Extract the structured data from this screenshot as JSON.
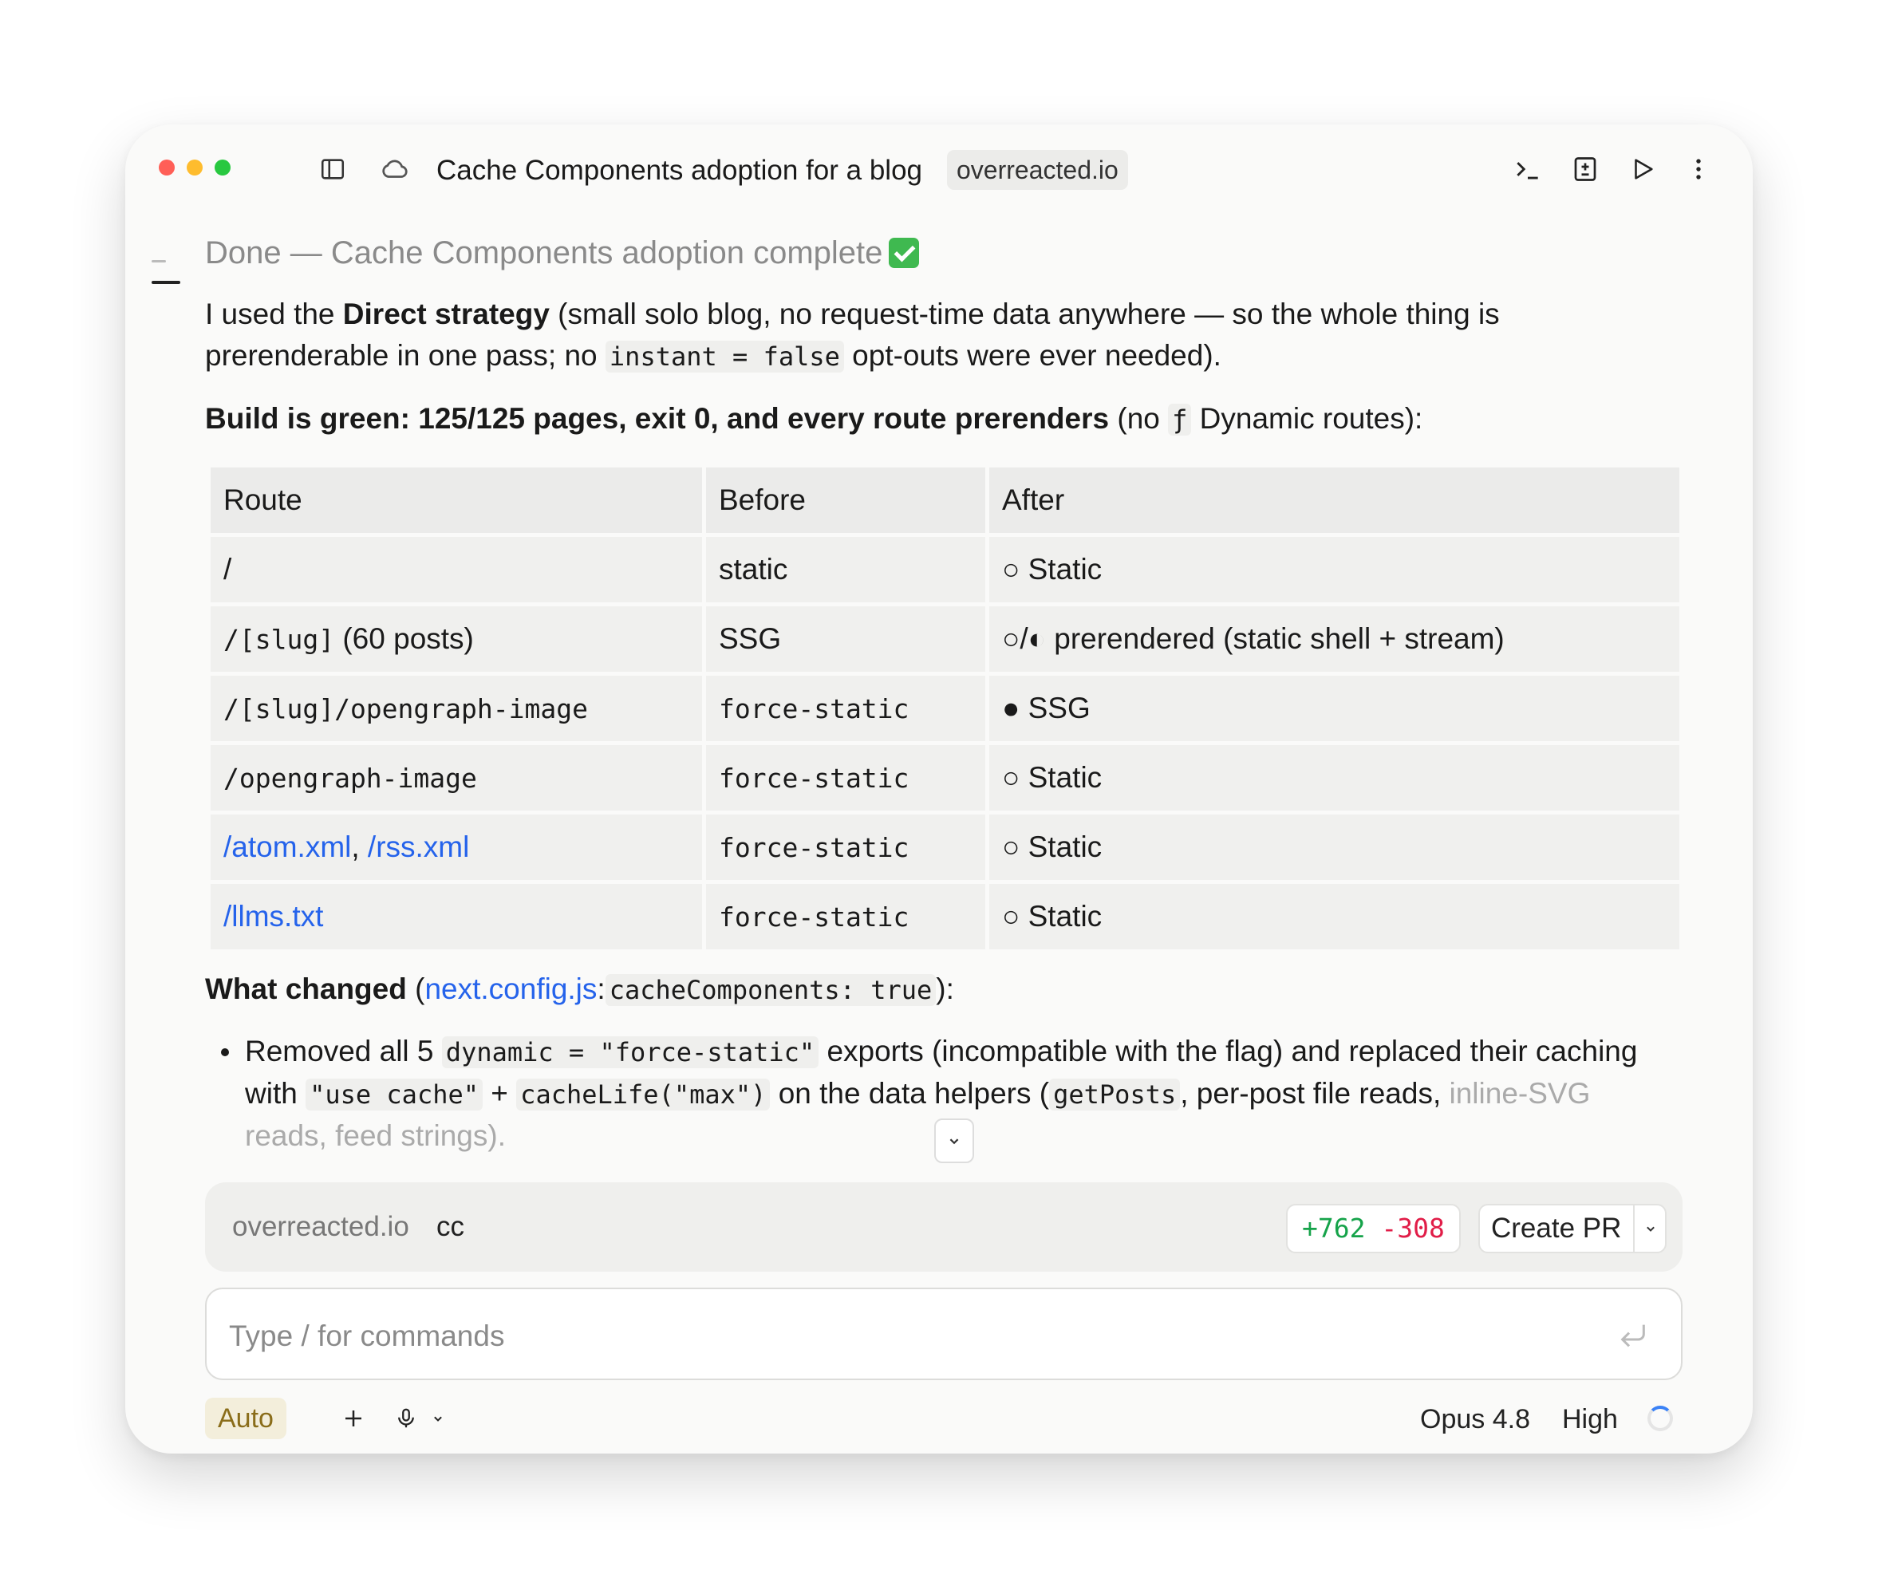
{
  "window": {
    "title": "Cache Components adoption for a blog",
    "repo_badge": "overreacted.io"
  },
  "message": {
    "heading": "Done — Cache Components adoption complete",
    "p1": {
      "t1": "I used the ",
      "bold": "Direct strategy",
      "t2": " (small solo blog, no request-time data anywhere — so the whole thing is prerenderable in one pass; no ",
      "code": "instant = false",
      "t3": " opt-outs were ever needed)."
    },
    "p2": {
      "bold": "Build is green: 125/125 pages, exit 0, and every route prerenders",
      "t1": " (no ",
      "code": "ƒ",
      "t2": " Dynamic routes):"
    },
    "table": {
      "headers": [
        "Route",
        "Before",
        "After"
      ],
      "rows": [
        {
          "route": "/",
          "route_kind": "text",
          "before": "static",
          "before_kind": "text",
          "after": "○ Static"
        },
        {
          "route": "/[slug]",
          "route_suffix": " (60 posts)",
          "route_kind": "mixed",
          "before": "SSG",
          "before_kind": "text",
          "after": "○/◐ prerendered (static shell + stream)"
        },
        {
          "route": "/[slug]/opengraph-image",
          "route_kind": "code",
          "before": "force-static",
          "before_kind": "code",
          "after": "● SSG"
        },
        {
          "route": "/opengraph-image",
          "route_kind": "code",
          "before": "force-static",
          "before_kind": "code",
          "after": "○ Static"
        },
        {
          "route": "/atom.xml",
          "route_sep": ", ",
          "route2": "/rss.xml",
          "route_kind": "links",
          "before": "force-static",
          "before_kind": "code",
          "after": "○ Static"
        },
        {
          "route": "/llms.txt",
          "route_kind": "link",
          "before": "force-static",
          "before_kind": "code",
          "after": "○ Static"
        }
      ]
    },
    "what_changed": {
      "bold": "What changed",
      "open": " (",
      "link": "next.config.js",
      "colon": ":",
      "code": "cacheComponents: true",
      "close": "):"
    },
    "bullet": {
      "t1": "Removed all 5 ",
      "code1": "dynamic = \"force-static\"",
      "t2": " exports (incompatible with the flag) and replaced their caching with ",
      "code2": "\"use cache\"",
      "t3": " + ",
      "code3": "cacheLife(\"max\")",
      "t4": " on the data helpers (",
      "code4": "getPosts",
      "t5": ", per-post file reads, ",
      "faded": "inline-SVG reads, feed strings)."
    }
  },
  "statusbar": {
    "repo": "overreacted.io",
    "branch": "cc",
    "additions": "+762",
    "deletions": "-308",
    "create_pr": "Create PR"
  },
  "composer": {
    "placeholder": "Type / for commands"
  },
  "bottom": {
    "mode": "Auto",
    "model": "Opus 4.8",
    "effort": "High"
  },
  "icons": {
    "sidebar": "sidebar-toggle-icon",
    "cloud": "cloud-icon",
    "terminal": "terminal-icon",
    "diff": "diff-icon",
    "run": "play-icon",
    "more": "more-vertical-icon"
  },
  "colors": {
    "link": "#2563eb",
    "additions": "#16a34a",
    "deletions": "#e11d48",
    "auto_chip_bg": "#f3eedb",
    "auto_chip_text": "#8a6d1a"
  }
}
